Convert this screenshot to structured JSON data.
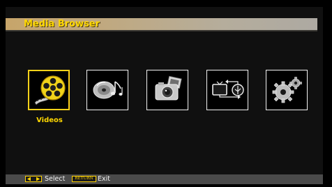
{
  "header": {
    "title": "Media Browser"
  },
  "menu": {
    "items": [
      {
        "name": "videos",
        "icon": "film-reel-icon",
        "label": "Videos",
        "selected": true
      },
      {
        "name": "music",
        "icon": "music-disc-icon",
        "label": "",
        "selected": false
      },
      {
        "name": "photos",
        "icon": "camera-photo-icon",
        "label": "",
        "selected": false
      },
      {
        "name": "dlna",
        "icon": "tv-usb-link-icon",
        "label": "",
        "selected": false
      },
      {
        "name": "settings",
        "icon": "gears-icon",
        "label": "",
        "selected": false
      }
    ],
    "selected_label": "Videos"
  },
  "footer": {
    "select_label": "Select",
    "return_key": "RETURN",
    "exit_label": "Exit"
  },
  "colors": {
    "accent": "#ffd800",
    "title_bar": "#c7a56a",
    "footer_bar": "#4a4a4a"
  }
}
